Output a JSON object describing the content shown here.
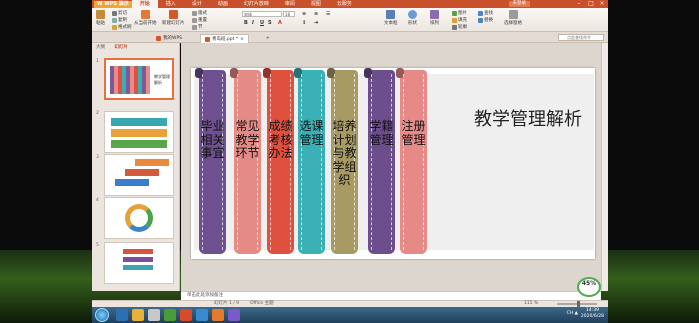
{
  "app": {
    "logo": "W WPS 演示",
    "menu_tabs": [
      "开始",
      "插入",
      "设计",
      "动画",
      "幻灯片放映",
      "审阅",
      "视图",
      "云服务"
    ],
    "active_menu": "开始",
    "login_label": "未登录"
  },
  "ribbon": {
    "paste_label": "粘贴",
    "cut_label": "剪切",
    "copy_label": "复制",
    "format_painter_label": "格式刷",
    "from_current_label": "从当前开始",
    "new_slide_label": "新建幻灯片",
    "layout_label": "版式",
    "reset_label": "重置",
    "section_label": "节",
    "font_name": "宋体",
    "font_size": "18",
    "text_box_label": "文本框",
    "shapes_label": "形状",
    "arrange_label": "排列",
    "picture_label": "图片",
    "fill_label": "填充",
    "outline_label": "轮廓",
    "find_label": "查找",
    "replace_label": "替换",
    "select_pane_label": "选择窗格"
  },
  "tabs": {
    "home_tab": "我的WPS",
    "doc_tab": "青岛班.ppt *",
    "search_placeholder": "点此查找命令"
  },
  "outline_panel": {
    "tab_outline": "大纲",
    "tab_slides": "幻灯片",
    "slide_numbers": [
      "1",
      "2",
      "3",
      "4",
      "5"
    ]
  },
  "slide": {
    "title": "教学管理解析",
    "ribbons": [
      {
        "text": "毕业相关事宜",
        "color": "#6e4f8f"
      },
      {
        "text": "常见教学环节",
        "color": "#e48b86"
      },
      {
        "text": "成绩考核办法",
        "color": "#e0503f"
      },
      {
        "text": "选课管理",
        "color": "#3aafb4"
      },
      {
        "text": "培养计划与教学组织",
        "color": "#a89a63"
      },
      {
        "text": "学籍管理",
        "color": "#6c4e8c"
      },
      {
        "text": "注册管理",
        "color": "#e58a86"
      }
    ]
  },
  "notes": {
    "placeholder": "单击此处添加备注"
  },
  "status": {
    "slide_counter": "幻灯片 1 / 9",
    "theme": "Office 主题",
    "zoom": "115 %",
    "zoom_fraction": 0.55
  },
  "overlay": {
    "percent": "45%"
  },
  "taskbar": {
    "time": "14:39",
    "date": "2020/6/28",
    "tray_label": "CH ▲"
  }
}
